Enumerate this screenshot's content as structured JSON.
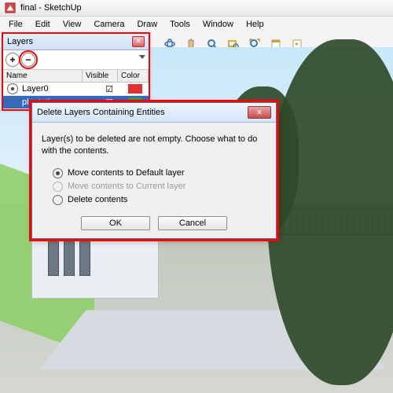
{
  "window": {
    "title": "final - SketchUp"
  },
  "menu": {
    "items": [
      "File",
      "Edit",
      "View",
      "Camera",
      "Draw",
      "Tools",
      "Window",
      "Help"
    ]
  },
  "layers_panel": {
    "title": "Layers",
    "columns": {
      "name": "Name",
      "visible": "Visible",
      "color": "Color"
    },
    "rows": [
      {
        "name": "Layer0",
        "visible": true,
        "color": "#e03030",
        "selected": false,
        "active": true
      },
      {
        "name": "plantation",
        "visible": true,
        "color": "#2aa24a",
        "selected": true,
        "active": false
      }
    ]
  },
  "dialog": {
    "title": "Delete Layers Containing Entities",
    "message": "Layer(s) to be deleted are not empty.  Choose what to do with the contents.",
    "options": {
      "move_default": "Move contents to Default layer",
      "move_current": "Move contents to Current layer",
      "delete": "Delete contents"
    },
    "buttons": {
      "ok": "OK",
      "cancel": "Cancel"
    }
  },
  "toolbar_icons": [
    "select-icon",
    "paint-icon",
    "eraser-icon",
    "push-pull-icon",
    "star1-icon",
    "orbit-icon",
    "zoom-extents-icon",
    "sep",
    "hand-icon",
    "pan-icon",
    "zoom-icon",
    "zoom-window-icon",
    "zoom-extents2-icon",
    "page-icon"
  ]
}
